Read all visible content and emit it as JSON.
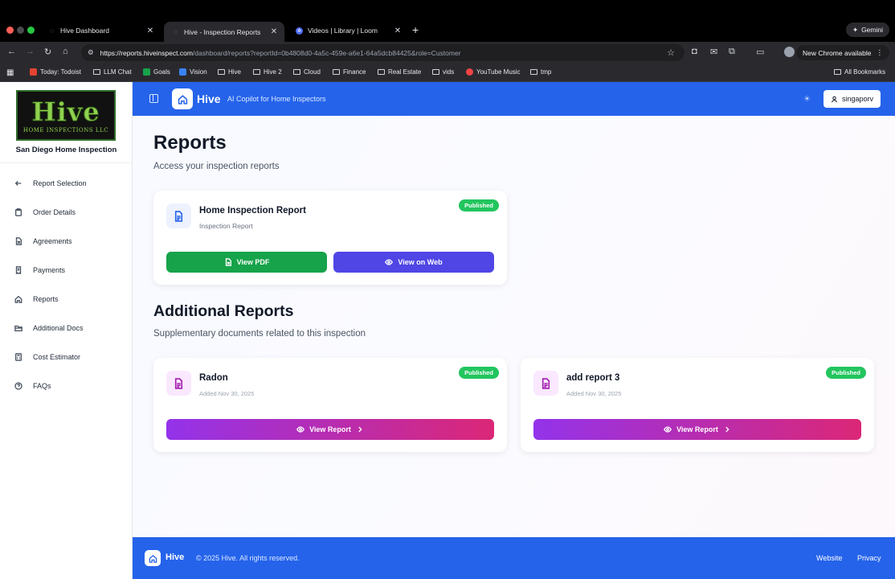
{
  "browser": {
    "tabs": [
      {
        "title": "Hive Dashboard"
      },
      {
        "title": "Hive - Inspection Reports"
      },
      {
        "title": "Videos | Library | Loom"
      }
    ],
    "gemini_label": "Gemini",
    "url_host": "https://reports.hiveinspect.com",
    "url_path": "/dashboard/reports?reportId=0b4808d0-4a5c-459e-a6e1-64a5dcb84425&role=Customer",
    "update_label": "New Chrome available",
    "bookmarks": [
      {
        "label": "Today: Todoist"
      },
      {
        "label": "LLM Chat"
      },
      {
        "label": "Goals"
      },
      {
        "label": "Vision"
      },
      {
        "label": "Hive"
      },
      {
        "label": "Hive 2"
      },
      {
        "label": "Cloud"
      },
      {
        "label": "Finance"
      },
      {
        "label": "Real Estate"
      },
      {
        "label": "vids"
      },
      {
        "label": "YouTube Music"
      },
      {
        "label": "tmp"
      }
    ],
    "all_bookmarks_label": "All Bookmarks"
  },
  "sidebar": {
    "logo_word": "Hive",
    "logo_sub": "HOME INSPECTIONS LLC",
    "company_name": "San Diego Home Inspection",
    "items": [
      {
        "label": "Report Selection",
        "icon": "arrow-left-icon"
      },
      {
        "label": "Order Details",
        "icon": "clipboard-icon"
      },
      {
        "label": "Agreements",
        "icon": "file-text-icon"
      },
      {
        "label": "Payments",
        "icon": "receipt-icon"
      },
      {
        "label": "Reports",
        "icon": "home-icon"
      },
      {
        "label": "Additional Docs",
        "icon": "folder-open-icon"
      },
      {
        "label": "Cost Estimator",
        "icon": "calculator-icon"
      },
      {
        "label": "FAQs",
        "icon": "help-circle-icon"
      }
    ]
  },
  "header": {
    "brand": "Hive",
    "tagline": "AI Copilot for Home Inspectors",
    "user": "singaporv"
  },
  "main": {
    "title": "Reports",
    "subtitle": "Access your inspection reports",
    "primary_report": {
      "title": "Home Inspection Report",
      "type": "Inspection Report",
      "status": "Published",
      "pdf_label": "View PDF",
      "web_label": "View on Web"
    },
    "additional_title": "Additional Reports",
    "additional_subtitle": "Supplementary documents related to this inspection",
    "additional": [
      {
        "title": "Radon",
        "date": "Added Nov 30, 2025",
        "status": "Published",
        "button": "View Report"
      },
      {
        "title": "add report 3",
        "date": "Added Nov 30, 2025",
        "status": "Published",
        "button": "View Report"
      }
    ]
  },
  "footer": {
    "brand": "Hive",
    "copyright": "© 2025 Hive. All rights reserved.",
    "links": [
      "Website",
      "Privacy"
    ]
  },
  "colors": {
    "primary_blue": "#2563eb",
    "published_green": "#22c55e",
    "pdf_green": "#16a34a",
    "web_indigo": "#4f46e5",
    "report_gradient_start": "#9333ea",
    "report_gradient_end": "#db2777"
  }
}
